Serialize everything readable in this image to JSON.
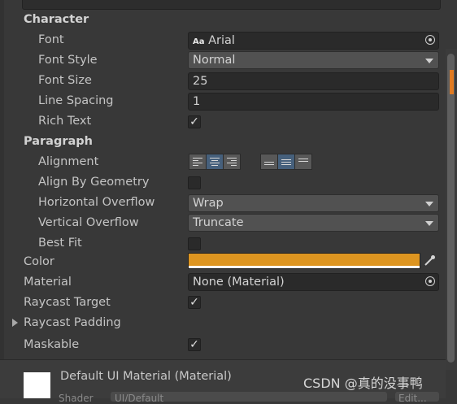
{
  "character": {
    "header": "Character",
    "font_label": "Font",
    "font_icon_text": "Aa",
    "font_value": "Arial",
    "font_style_label": "Font Style",
    "font_style_value": "Normal",
    "font_size_label": "Font Size",
    "font_size_value": "25",
    "line_spacing_label": "Line Spacing",
    "line_spacing_value": "1",
    "rich_text_label": "Rich Text",
    "rich_text_checked": true
  },
  "paragraph": {
    "header": "Paragraph",
    "alignment_label": "Alignment",
    "horizontal_alignment_selected": "center",
    "vertical_alignment_selected": "middle",
    "align_by_geometry_label": "Align By Geometry",
    "align_by_geometry_checked": false,
    "horizontal_overflow_label": "Horizontal Overflow",
    "horizontal_overflow_value": "Wrap",
    "vertical_overflow_label": "Vertical Overflow",
    "vertical_overflow_value": "Truncate",
    "best_fit_label": "Best Fit",
    "best_fit_checked": false
  },
  "color": {
    "label": "Color",
    "value": "#DE9520"
  },
  "material": {
    "label": "Material",
    "value": "None (Material)"
  },
  "raycast_target": {
    "label": "Raycast Target",
    "checked": true
  },
  "raycast_padding": {
    "label": "Raycast Padding"
  },
  "maskable": {
    "label": "Maskable",
    "checked": true
  },
  "material_preview": {
    "title": "Default UI Material (Material)",
    "shader_label": "Shader",
    "shader_value": "UI/Default",
    "edit_button": "Edit..."
  },
  "watermark": "CSDN @真的没事鸭",
  "check_glyph": "✓",
  "accent_color": "#46607c"
}
